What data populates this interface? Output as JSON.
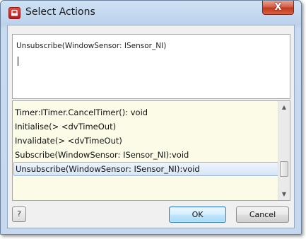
{
  "window": {
    "title": "Select Actions",
    "close_label": "X",
    "icon": "app-logo-icon"
  },
  "editor": {
    "value": "Unsubscribe(WindowSensor: ISensor_NI)"
  },
  "actions_list": {
    "items": [
      "Timer:ITimer.CancelTimer(): void",
      "Initialise(> <dvTimeOut)",
      "Invalidate(> <dvTimeOut)",
      "Subscribe(WindowSensor: ISensor_NI):void",
      "Unsubscribe(WindowSensor: ISensor_NI):void"
    ],
    "selected_index": 4
  },
  "footer": {
    "help_label": "?",
    "ok_label": "OK",
    "cancel_label": "Cancel"
  },
  "colors": {
    "list_background": "#fcfbe7",
    "selection": "#d6e5f7",
    "close_button": "#c0391f"
  }
}
